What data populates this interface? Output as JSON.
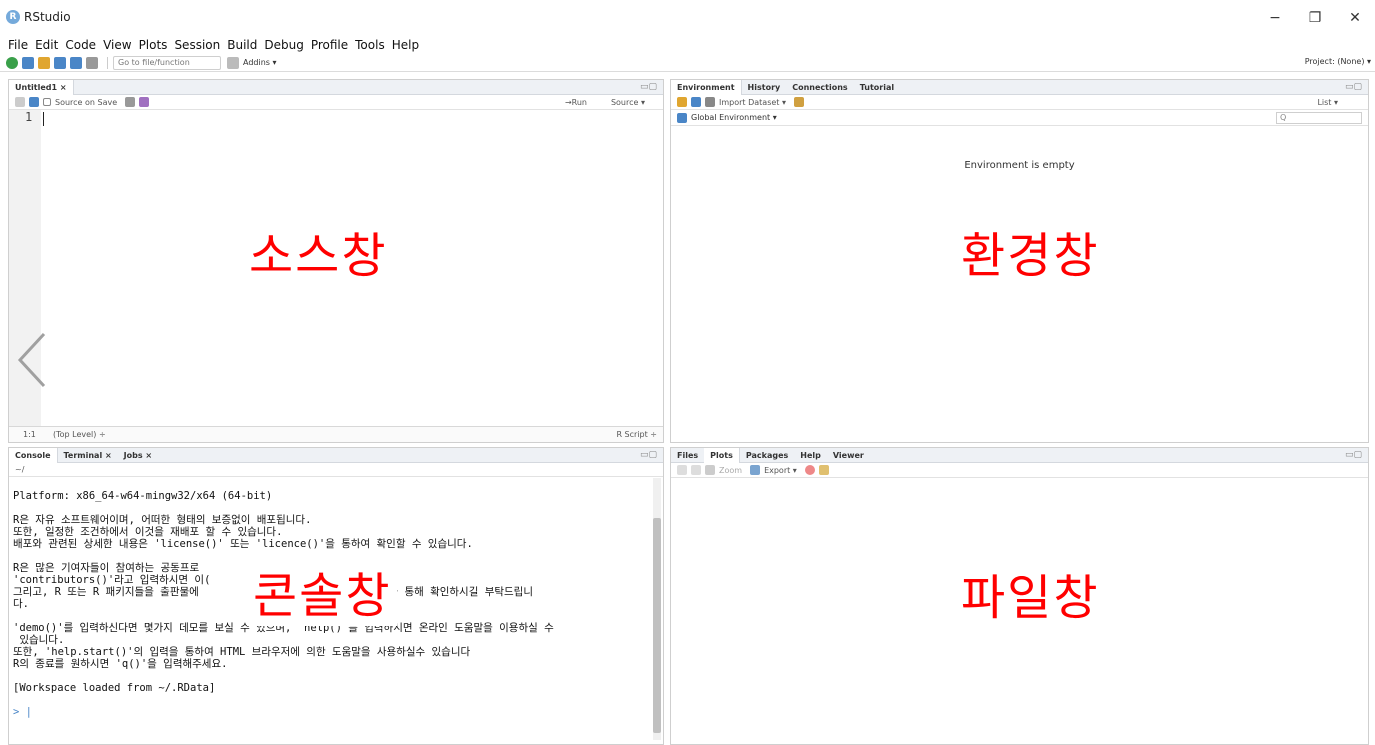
{
  "window": {
    "title": "RStudio",
    "minimize": "−",
    "maximize": "❐",
    "close": "✕"
  },
  "menu": [
    "File",
    "Edit",
    "Code",
    "View",
    "Plots",
    "Session",
    "Build",
    "Debug",
    "Profile",
    "Tools",
    "Help"
  ],
  "toolbar": {
    "goto_placeholder": "Go to file/function",
    "addins": "Addins ▾",
    "project": "Project: (None) ▾"
  },
  "source": {
    "tab": "Untitled1 ×",
    "source_on_save": "Source on Save",
    "run": "→Run",
    "source_btn": "Source ▾",
    "line_number": "1",
    "status_pos": "1:1",
    "status_level": "(Top Level) ÷",
    "status_type": "R Script ÷",
    "overlay_label": "소스창"
  },
  "environment": {
    "tabs": [
      "Environment",
      "History",
      "Connections",
      "Tutorial"
    ],
    "import_dataset": "Import Dataset ▾",
    "list_btn": "List ▾",
    "scope": "Global Environment ▾",
    "search_placeholder": "Q",
    "empty_message": "Environment is empty",
    "overlay_label": "환경창"
  },
  "console": {
    "tabs": [
      "Console",
      "Terminal ×",
      "Jobs ×"
    ],
    "path": "~/",
    "lines": [
      "Platform: x86_64-w64-mingw32/x64 (64-bit)",
      "",
      "R은 자유 소프트웨어이며, 어떠한 형태의 보증없이 배포됩니다.",
      "또한, 일정한 조건하에서 이것을 재배포 할 수 있습니다.",
      "배포와 관련된 상세한 내용은 'license()' 또는 'licence()'을 통하여 확인할 수 있습니다.",
      "",
      "R은 많은 기여자들이 참여하는 공동프로                      수 있습니다.",
      "'contributors()'라고 입력하시면 이(",
      "그리고, R 또는 R 패키지들을 출판물에                       tion()'을 통해 확인하시길 부탁드립니",
      "다.",
      "",
      "'demo()'를 입력하신다면 몇가지 데모를 보실 수 있으며, 'help()'를 입력하시면 온라인 도움말을 이용하실 수",
      " 있습니다.",
      "또한, 'help.start()'의 입력을 통하여 HTML 브라우저에 의한 도움말을 사용하실수 있습니다",
      "R의 종료를 원하시면 'q()'을 입력해주세요.",
      "",
      "[Workspace loaded from ~/.RData]",
      "",
      "> |"
    ],
    "overlay_label": "콘솔창"
  },
  "files": {
    "tabs": [
      "Files",
      "Plots",
      "Packages",
      "Help",
      "Viewer"
    ],
    "zoom": "Zoom",
    "export": "Export ▾",
    "overlay_label": "파일창"
  },
  "colors": {
    "overlay_text": "#ff0000",
    "tab_bar": "#eef1f5",
    "accent_blue": "#4a86c7"
  }
}
